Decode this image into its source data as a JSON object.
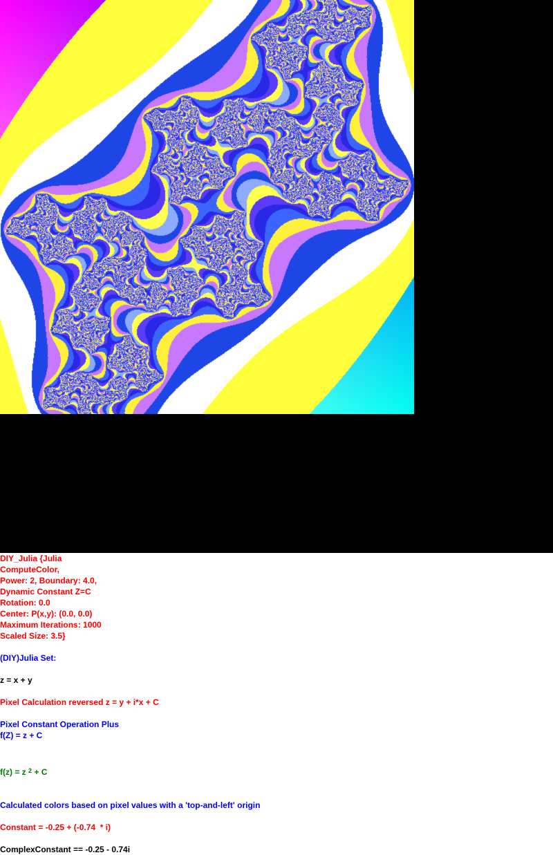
{
  "palette": {
    "background_top": "#000000",
    "background_text": "#ffffff",
    "red": "#ff0000",
    "blue": "#0000ff",
    "black": "#000000",
    "green": "#008000",
    "magenta": "#ff00ff",
    "cyan": "#00ffff",
    "yellow": "#ffff40",
    "deep_blue": "#0030e0"
  },
  "info": {
    "line_01": "DIY_Julia {Julia",
    "line_02": "ComputeColor,",
    "line_03": "Power: 2, Boundary: 4.0,",
    "line_04": "Dynamic Constant Z=C",
    "line_05": "Rotation: 0.0",
    "line_06": "Center: P(x,y): (0.0, 0.0)",
    "line_07": "Maximum Iterations: 1000",
    "line_08": "Scaled Size: 3.5}",
    "line_09": "(DIY)Julia Set:",
    "line_10": "z = x + y",
    "line_11": "Pixel Calculation reversed z = y + i*x + C",
    "line_12": "Pixel Constant Operation Plus",
    "line_13": "f(Z) = z + C",
    "formula_prefix": "f(z) = z ",
    "formula_power": "2",
    "formula_suffix": " + C",
    "line_15": "Calculated colors based on pixel values with a 'top-and-left' origin",
    "line_16": "Constant = -0.25 + (-0.74  * i)",
    "line_17": "ComplexConstant == -0.25 - 0.74i"
  },
  "fractal": {
    "constant_re": -0.25,
    "constant_im": -0.74,
    "power": 2,
    "boundary": 4.0,
    "max_iterations": 1000,
    "scaled_size": 3.5,
    "center": [
      0.0,
      0.0
    ],
    "rotation": 0.0
  }
}
